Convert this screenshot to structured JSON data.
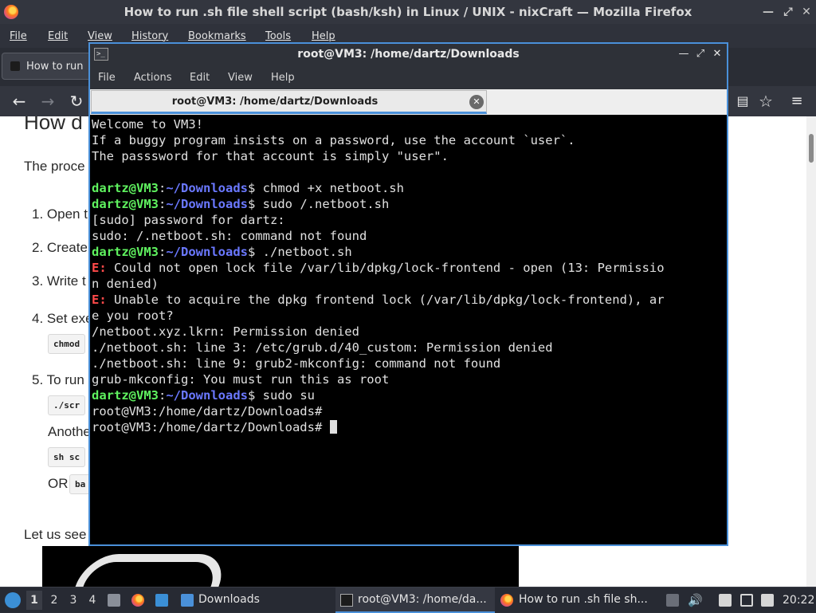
{
  "firefox": {
    "window_title": "How to run .sh file shell script (bash/ksh) in Linux / UNIX - nixCraft — Mozilla Firefox",
    "menu": [
      "File",
      "Edit",
      "View",
      "History",
      "Bookmarks",
      "Tools",
      "Help"
    ],
    "tab_label": "How to run",
    "page": {
      "heading": "How d",
      "intro": "The proce",
      "steps": [
        "1. Open t",
        "2. Create",
        "3. Write t",
        "4. Set exe",
        "5. To run"
      ],
      "code_chmod": "chmod",
      "code_scr": "./scr",
      "another": "Anothe",
      "code_sh": "sh sc",
      "or": "OR",
      "code_ba": "ba",
      "let_us": "Let us see"
    }
  },
  "terminal": {
    "window_title": "root@VM3: /home/dartz/Downloads",
    "menu": [
      "File",
      "Actions",
      "Edit",
      "View",
      "Help"
    ],
    "tab_label": "root@VM3: /home/dartz/Downloads",
    "prompt_user": "dartz@VM3",
    "prompt_path": "~/Downloads",
    "lines": {
      "l1": "Welcome to VM3!",
      "l2": "If a buggy program insists on a password, use the account `user`.",
      "l3": "The passsword for that account is simply \"user\".",
      "c1": "chmod +x netboot.sh",
      "c2": "sudo /.netboot.sh",
      "l6": "[sudo] password for dartz:",
      "l7": "sudo: /.netboot.sh: command not found",
      "c3": "./netboot.sh",
      "e_tag": "E:",
      "e1a": "Could not open lock file /var/lib/dpkg/lock-frontend - open (13: Permissio",
      "e1b": "n denied)",
      "e2a": "Unable to acquire the dpkg frontend lock (/var/lib/dpkg/lock-frontend), ar",
      "e2b": "e you root?",
      "l14": "/netboot.xyz.lkrn: Permission denied",
      "l15": "./netboot.sh: line 3: /etc/grub.d/40_custom: Permission denied",
      "l16": "./netboot.sh: line 9: grub2-mkconfig: command not found",
      "l17": "grub-mkconfig: You must run this as root",
      "c4": "sudo su",
      "r1": "root@VM3:/home/dartz/Downloads#",
      "r2": "root@VM3:/home/dartz/Downloads# "
    }
  },
  "taskbar": {
    "workspaces": [
      "1",
      "2",
      "3",
      "4"
    ],
    "tasks": {
      "downloads": "Downloads",
      "terminal": "root@VM3: /home/da...",
      "firefox": "How to run .sh file sh..."
    },
    "clock": "20:22"
  },
  "colors": {
    "terminal_border": "#4a90d9",
    "prompt_user": "#5ff25f",
    "prompt_path": "#6a78ff",
    "error": "#ff4a4a"
  }
}
